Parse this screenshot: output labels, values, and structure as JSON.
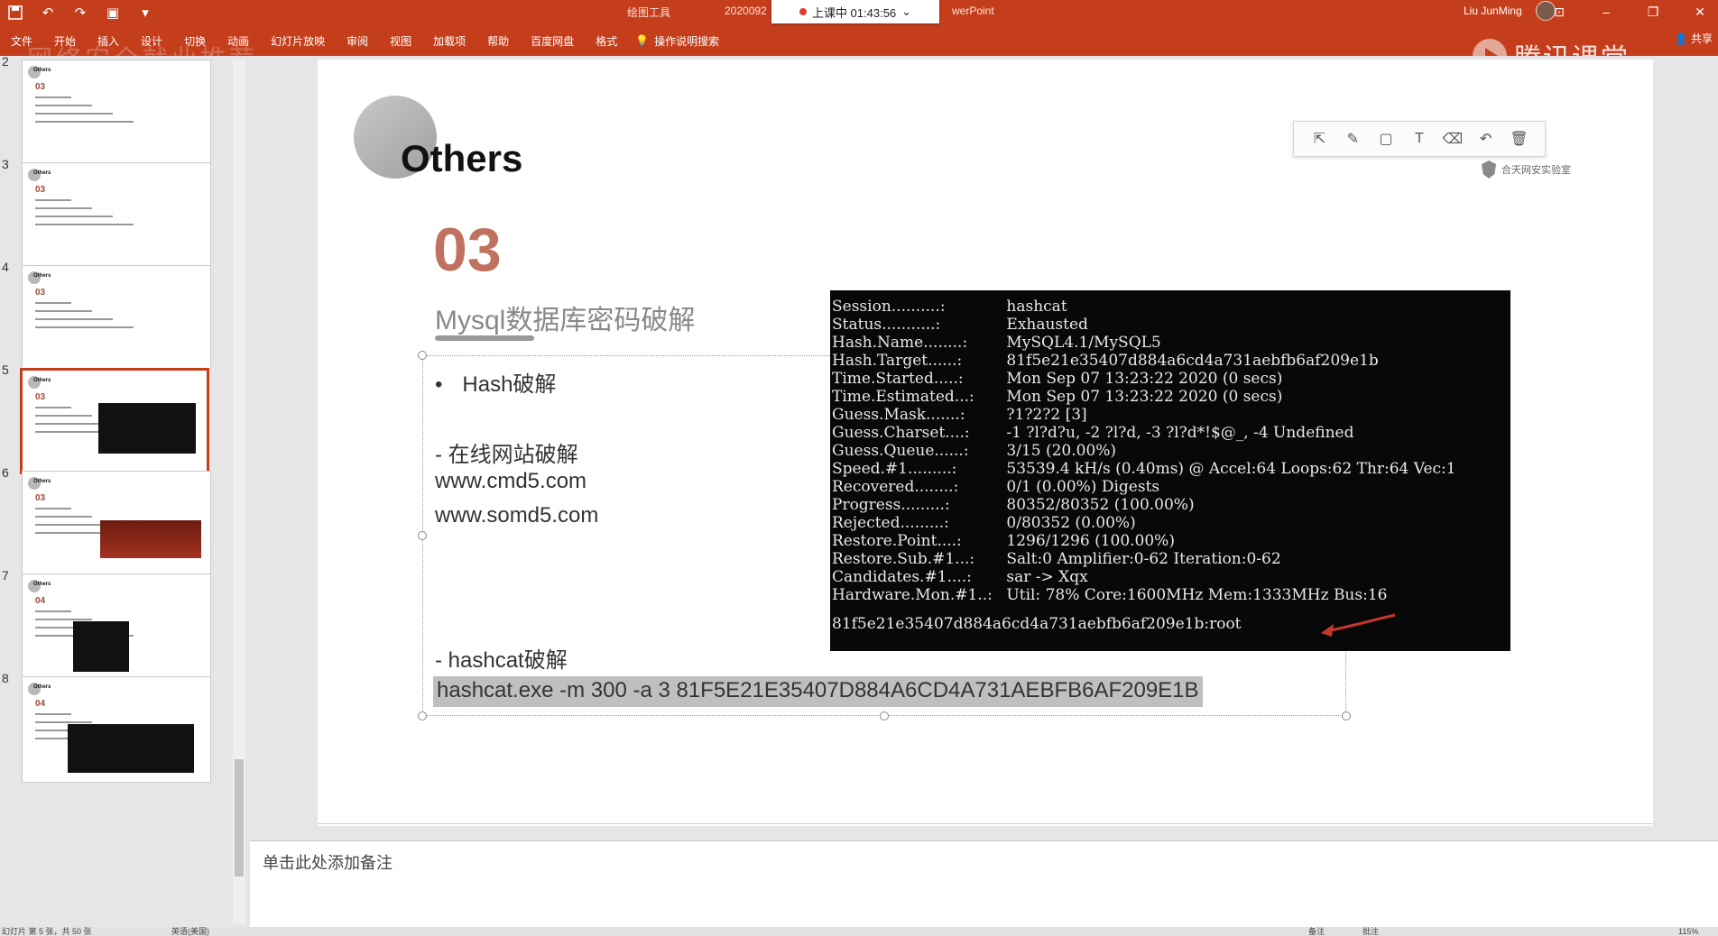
{
  "app": {
    "doc_title": "绘图工具",
    "doc_date": "2020092",
    "app_suffix": "werPoint",
    "live_badge": "上课中 01:43:56",
    "user_name": "Liu JunMing",
    "tencent_logo_text": "腾讯课堂",
    "share_label": "共享",
    "watermark_left": "网络安全就业推荐"
  },
  "ribbon": {
    "tabs": [
      "文件",
      "开始",
      "插入",
      "设计",
      "切换",
      "动画",
      "幻灯片放映",
      "审阅",
      "视图",
      "加载项",
      "帮助",
      "百度网盘",
      "格式"
    ],
    "tell_me": "操作说明搜索"
  },
  "thumbnails": [
    {
      "num": "2",
      "title": "Others",
      "sec": "03"
    },
    {
      "num": "3",
      "title": "Others",
      "sec": "03"
    },
    {
      "num": "4",
      "title": "Others",
      "sec": "03"
    },
    {
      "num": "5",
      "title": "Others",
      "sec": "03"
    },
    {
      "num": "6",
      "title": "Others",
      "sec": "03"
    },
    {
      "num": "7",
      "title": "Others",
      "sec": "04"
    },
    {
      "num": "8",
      "title": "Others",
      "sec": "04"
    }
  ],
  "slide": {
    "title": "Others",
    "logo_text": "合天网安实验室",
    "section_num": "03",
    "section_title": "Mysql数据库密码破解",
    "bullet": "Hash破解",
    "bullet_symbol": "•",
    "online_header": "- 在线网站破解",
    "url1": "www.cmd5.com",
    "url2": "www.somd5.com",
    "hashcat_header": "- hashcat破解",
    "command": "hashcat.exe -m 300 -a 3 81F5E21E35407D884A6CD4A731AEBFB6AF209E1B"
  },
  "terminal": {
    "rows": [
      {
        "k": "Session..........:",
        "v": " hashcat"
      },
      {
        "k": "Status...........:",
        "v": " Exhausted"
      },
      {
        "k": "Hash.Name........:",
        "v": " MySQL4.1/MySQL5"
      },
      {
        "k": "Hash.Target......:",
        "v": " 81f5e21e35407d884a6cd4a731aebfb6af209e1b"
      },
      {
        "k": "Time.Started.....:",
        "v": " Mon Sep 07 13:23:22 2020 (0 secs)"
      },
      {
        "k": "Time.Estimated...:",
        "v": " Mon Sep 07 13:23:22 2020 (0 secs)"
      },
      {
        "k": "Guess.Mask.......:",
        "v": " ?1?2?2 [3]"
      },
      {
        "k": "Guess.Charset....:",
        "v": " -1 ?l?d?u, -2 ?l?d, -3 ?l?d*!$@_, -4 Undefined"
      },
      {
        "k": "Guess.Queue......:",
        "v": " 3/15 (20.00%)"
      },
      {
        "k": "Speed.#1.........:",
        "v": " 53539.4 kH/s (0.40ms) @ Accel:64 Loops:62 Thr:64 Vec:1"
      },
      {
        "k": "Recovered........:",
        "v": " 0/1 (0.00%) Digests"
      },
      {
        "k": "Progress.........:",
        "v": " 80352/80352 (100.00%)"
      },
      {
        "k": "Rejected.........:",
        "v": " 0/80352 (0.00%)"
      },
      {
        "k": "Restore.Point....:",
        "v": " 1296/1296 (100.00%)"
      },
      {
        "k": "Restore.Sub.#1...:",
        "v": " Salt:0 Amplifier:0-62 Iteration:0-62"
      },
      {
        "k": "Candidates.#1....:",
        "v": " sar -> Xqx"
      },
      {
        "k": "Hardware.Mon.#1..:",
        "v": " Util: 78% Core:1600MHz Mem:1333MHz Bus:16"
      }
    ],
    "result": "81f5e21e35407d884a6cd4a731aebfb6af209e1b:root"
  },
  "notes": {
    "placeholder": "单击此处添加备注"
  },
  "statusbar": {
    "left": "幻灯片 第 5 张，共 50 张",
    "lang": "英语(美国)",
    "notes": "备注",
    "comments": "批注",
    "zoom": "115%"
  },
  "colors": {
    "ribbon": "#c43e1c",
    "accent_number": "#b45a44",
    "terminal_bg": "#080808",
    "arrow": "#c0392b"
  }
}
